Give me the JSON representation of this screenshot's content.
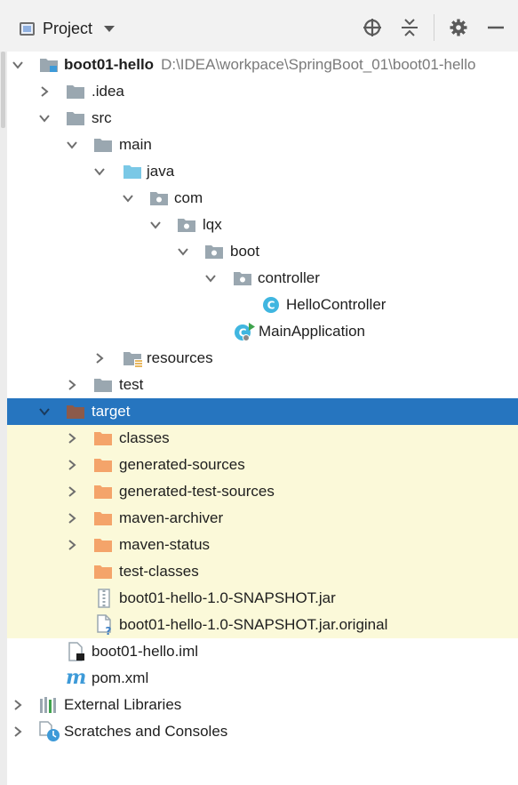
{
  "header": {
    "view_label": "Project",
    "icons": [
      "target-icon",
      "collapse-all-icon",
      "gear-icon",
      "minimize-icon"
    ]
  },
  "tree": {
    "root": {
      "name": "boot01-hello",
      "path": "D:\\IDEA\\workpace\\SpringBoot_01\\boot01-hello"
    },
    "idea": ".idea",
    "src": "src",
    "main": "main",
    "java": "java",
    "com": "com",
    "lqx": "lqx",
    "boot": "boot",
    "controller": "controller",
    "hello_controller": "HelloController",
    "main_application": "MainApplication",
    "resources": "resources",
    "test": "test",
    "target": "target",
    "classes": "classes",
    "generated_sources": "generated-sources",
    "generated_test_sources": "generated-test-sources",
    "maven_archiver": "maven-archiver",
    "maven_status": "maven-status",
    "test_classes": "test-classes",
    "jar": "boot01-hello-1.0-SNAPSHOT.jar",
    "jar_original": "boot01-hello-1.0-SNAPSHOT.jar.original",
    "iml": "boot01-hello.iml",
    "pom": "pom.xml",
    "external_libraries": "External Libraries",
    "scratches": "Scratches and Consoles"
  },
  "colors": {
    "selection": "#2675bf",
    "excluded_bg": "#fbf9d9",
    "folder_gray": "#9aa7b0",
    "folder_orange": "#f4a46a",
    "source_blue": "#7ac8e6",
    "class_badge": "#40b6e0",
    "target_brown": "#8c5a4a"
  }
}
